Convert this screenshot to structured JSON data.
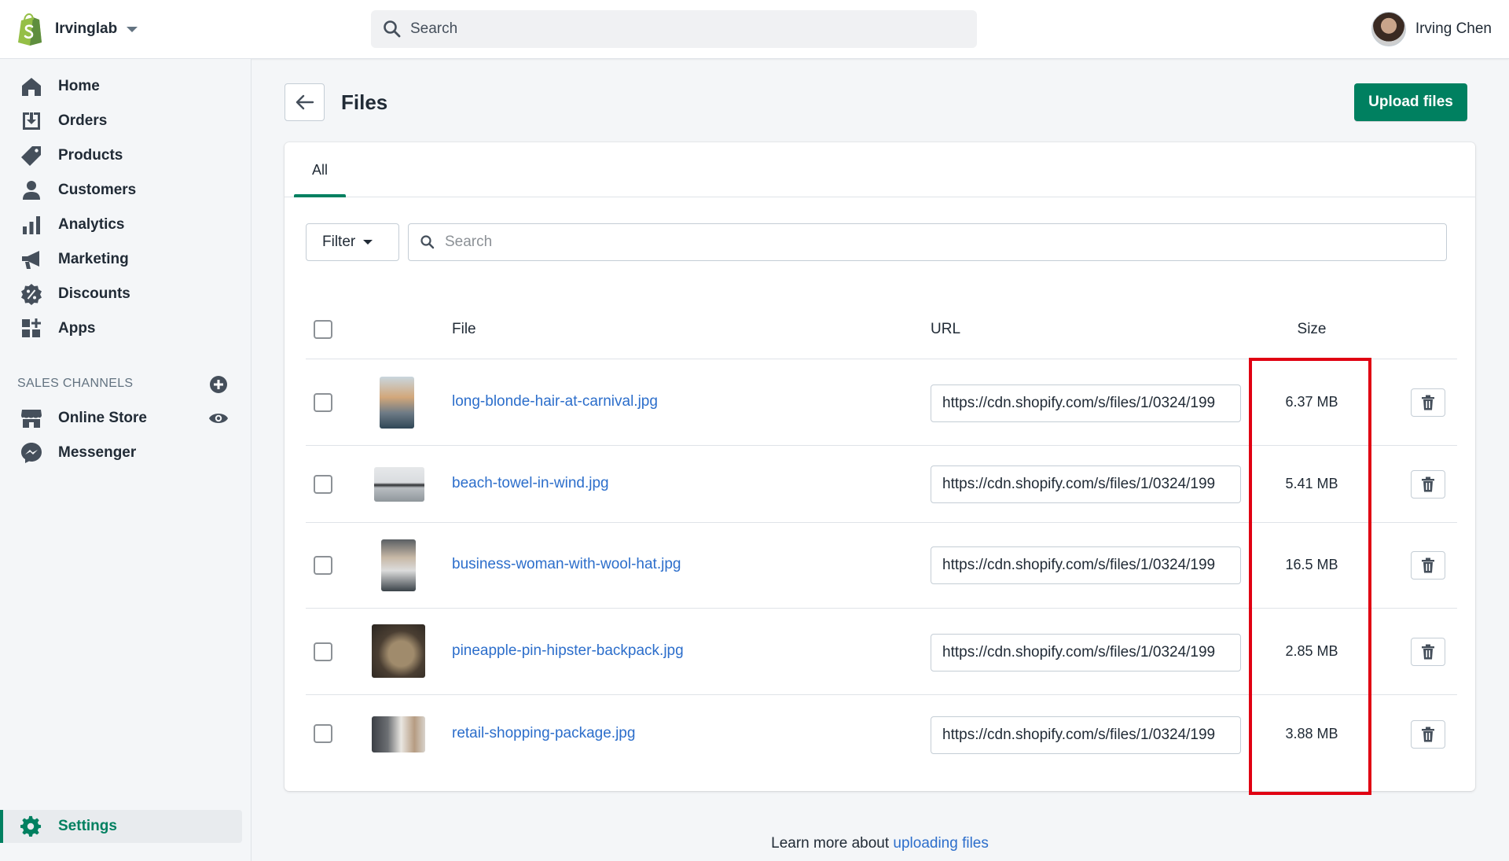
{
  "topbar": {
    "store_name": "Irvinglab",
    "search_placeholder": "Search",
    "user_name": "Irving Chen"
  },
  "sidebar": {
    "items": [
      {
        "label": "Home",
        "icon": "home-icon"
      },
      {
        "label": "Orders",
        "icon": "orders-icon"
      },
      {
        "label": "Products",
        "icon": "tag-icon"
      },
      {
        "label": "Customers",
        "icon": "person-icon"
      },
      {
        "label": "Analytics",
        "icon": "bar-chart-icon"
      },
      {
        "label": "Marketing",
        "icon": "megaphone-icon"
      },
      {
        "label": "Discounts",
        "icon": "discount-icon"
      },
      {
        "label": "Apps",
        "icon": "apps-icon"
      }
    ],
    "sales_channels_title": "SALES CHANNELS",
    "channels": [
      {
        "label": "Online Store",
        "icon": "store-icon"
      },
      {
        "label": "Messenger",
        "icon": "messenger-icon"
      }
    ],
    "settings_label": "Settings"
  },
  "page": {
    "title": "Files",
    "upload_label": "Upload files",
    "tab_all": "All",
    "filter_label": "Filter",
    "search_placeholder": "Search"
  },
  "table": {
    "headers": {
      "file": "File",
      "url": "URL",
      "size": "Size"
    },
    "rows": [
      {
        "name": "long-blonde-hair-at-carnival.jpg",
        "url": "https://cdn.shopify.com/s/files/1/0324/199",
        "size": "6.37 MB"
      },
      {
        "name": "beach-towel-in-wind.jpg",
        "url": "https://cdn.shopify.com/s/files/1/0324/199",
        "size": "5.41 MB"
      },
      {
        "name": "business-woman-with-wool-hat.jpg",
        "url": "https://cdn.shopify.com/s/files/1/0324/199",
        "size": "16.5 MB"
      },
      {
        "name": "pineapple-pin-hipster-backpack.jpg",
        "url": "https://cdn.shopify.com/s/files/1/0324/199",
        "size": "2.85 MB"
      },
      {
        "name": "retail-shopping-package.jpg",
        "url": "https://cdn.shopify.com/s/files/1/0324/199",
        "size": "3.88 MB"
      }
    ]
  },
  "footer": {
    "prefix": "Learn more about ",
    "link": "uploading files"
  },
  "colors": {
    "accent": "#008060",
    "link": "#2c6ecb",
    "highlight": "#e00012"
  }
}
